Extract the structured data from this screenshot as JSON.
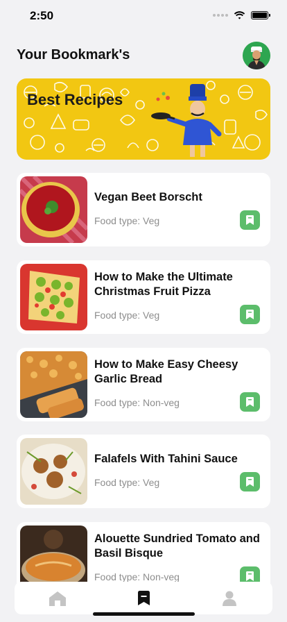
{
  "status": {
    "time": "2:50"
  },
  "header": {
    "title": "Your Bookmark's"
  },
  "banner": {
    "title": "Best Recipes"
  },
  "recipes": [
    {
      "title_line1": "Vegan Beet Borscht",
      "title_line2": "",
      "food_type": "Food type: Veg",
      "bookmark_icon": "bookmark-icon"
    },
    {
      "title_line1": "How to Make the Ultimate",
      "title_line2": "Christmas Fruit Pizza",
      "food_type": "Food type: Veg",
      "bookmark_icon": "bookmark-icon"
    },
    {
      "title_line1": "How to Make Easy Cheesy",
      "title_line2": "Garlic Bread",
      "food_type": "Food type: Non-veg",
      "bookmark_icon": "bookmark-icon"
    },
    {
      "title_line1": "Falafels With Tahini Sauce",
      "title_line2": "",
      "food_type": "Food type: Veg",
      "bookmark_icon": "bookmark-icon"
    },
    {
      "title_line1": "Alouette Sundried Tomato and",
      "title_line2": "Basil Bisque",
      "food_type": "Food type: Non-veg",
      "bookmark_icon": "bookmark-icon"
    }
  ],
  "tab_bar": {
    "tabs": [
      {
        "icon": "home-icon",
        "active": false
      },
      {
        "icon": "bookmark-icon",
        "active": true
      },
      {
        "icon": "profile-icon",
        "active": false
      }
    ]
  },
  "colors": {
    "accent_green": "#5cbd6b",
    "banner_yellow": "#f2c712",
    "background": "#f2f2f4",
    "muted_text": "#8d8d8d",
    "inactive_tab": "#c4c4c4"
  }
}
